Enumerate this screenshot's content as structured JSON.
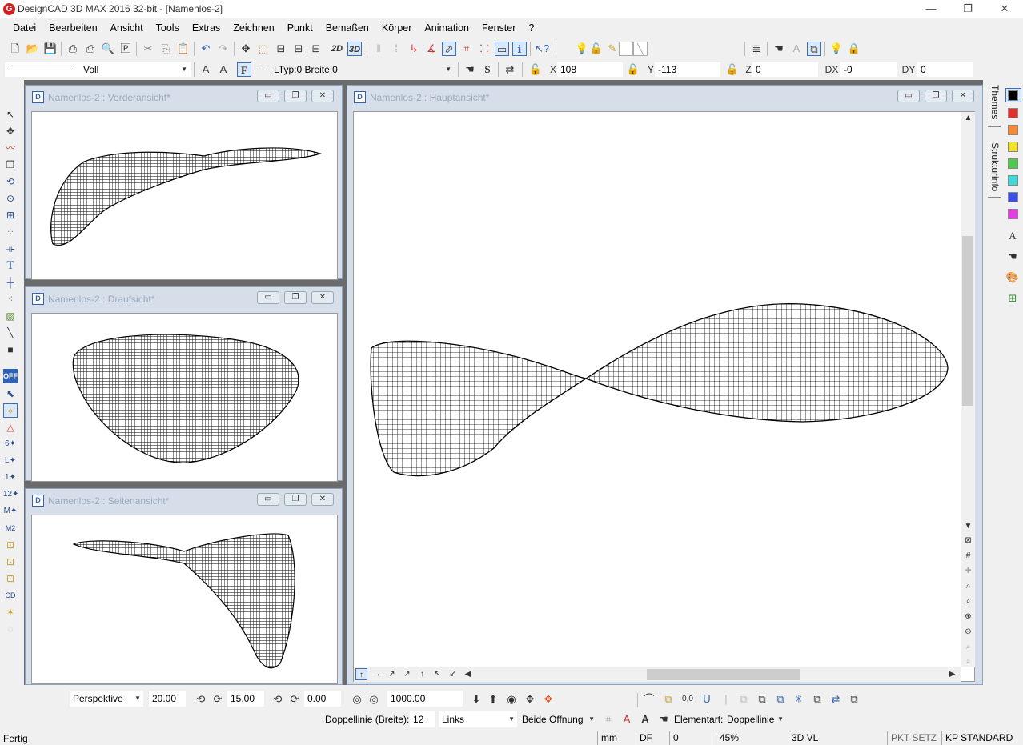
{
  "app": {
    "title": "DesignCAD 3D MAX 2016 32-bit - [Namenlos-2]",
    "icon_letter": "G",
    "window_controls": {
      "minimize": "—",
      "restore": "❐",
      "close": "✕"
    }
  },
  "menu": [
    "Datei",
    "Bearbeiten",
    "Ansicht",
    "Tools",
    "Extras",
    "Zeichnen",
    "Punkt",
    "Bemaßen",
    "Körper",
    "Animation",
    "Fenster",
    "?"
  ],
  "toolbar1": {
    "view_2d": "2D",
    "view_3d": "3D",
    "layer_star": "*",
    "layer_value": "1"
  },
  "toolbar2": {
    "line_style": "Voll",
    "bold_label": "F",
    "ltype_text": "LTyp:0  Breite:0",
    "s_label": "S",
    "x_label": "X",
    "x_value": "108",
    "y_label": "Y",
    "y_value": "-113",
    "z_label": "Z",
    "z_value": "0",
    "dx_label": "DX",
    "dx_value": "-0",
    "dy_label": "DY",
    "dy_value": "0"
  },
  "views": {
    "front": {
      "title": "Namenlos-2 : Vorderansicht*"
    },
    "top": {
      "title": "Namenlos-2 : Draufsicht*"
    },
    "side": {
      "title": "Namenlos-2 : Seitenansicht*"
    },
    "main": {
      "title": "Namenlos-2 : Hauptansicht*"
    },
    "doc_icon": "D"
  },
  "right_panel": {
    "tabs": [
      "Themes",
      "Strukturinfo"
    ],
    "swatches": [
      "#000000",
      "#e03030",
      "#f08c3c",
      "#f0e030",
      "#50c850",
      "#40d8d8",
      "#3c50e0",
      "#e040e0"
    ]
  },
  "viewbar": {
    "projection": "Perspektive",
    "angle1": "20.00",
    "angle2": "15.00",
    "angle3": "0.00",
    "distance": "1000.00"
  },
  "linebar": {
    "label": "Doppellinie (Breite):",
    "width": "12",
    "align": "Links",
    "opening": "Beide Öffnung",
    "element_label": "Elementart:",
    "element_value": "Doppellinie"
  },
  "status": {
    "message": "Fertig",
    "unit": "mm",
    "mode": "DF",
    "value": "0",
    "zoom": "45%",
    "view": "3D VL",
    "pkt": "PKT SETZ",
    "kp": "KP STANDARD"
  }
}
